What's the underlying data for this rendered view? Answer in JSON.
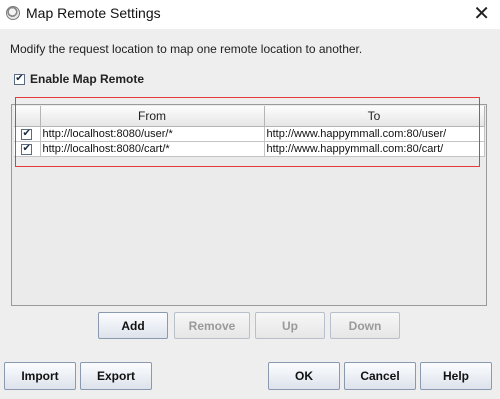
{
  "window": {
    "title": "Map Remote Settings",
    "close_glyph": "✕"
  },
  "description": "Modify the request location to map one remote location to another.",
  "enable": {
    "label": "Enable Map Remote",
    "checked": true
  },
  "table": {
    "columns": [
      "",
      "From",
      "To"
    ],
    "rows": [
      {
        "enabled": true,
        "from": "http://localhost:8080/user/*",
        "to": "http://www.happymmall.com:80/user/"
      },
      {
        "enabled": true,
        "from": "http://localhost:8080/cart/*",
        "to": "http://www.happymmall.com:80/cart/"
      }
    ]
  },
  "table_buttons": {
    "add": "Add",
    "remove": "Remove",
    "up": "Up",
    "down": "Down"
  },
  "footer_buttons": {
    "import": "Import",
    "export": "Export",
    "ok": "OK",
    "cancel": "Cancel",
    "help": "Help"
  },
  "colors": {
    "highlight": "#e23c3c",
    "button_border": "#8a99b0"
  }
}
